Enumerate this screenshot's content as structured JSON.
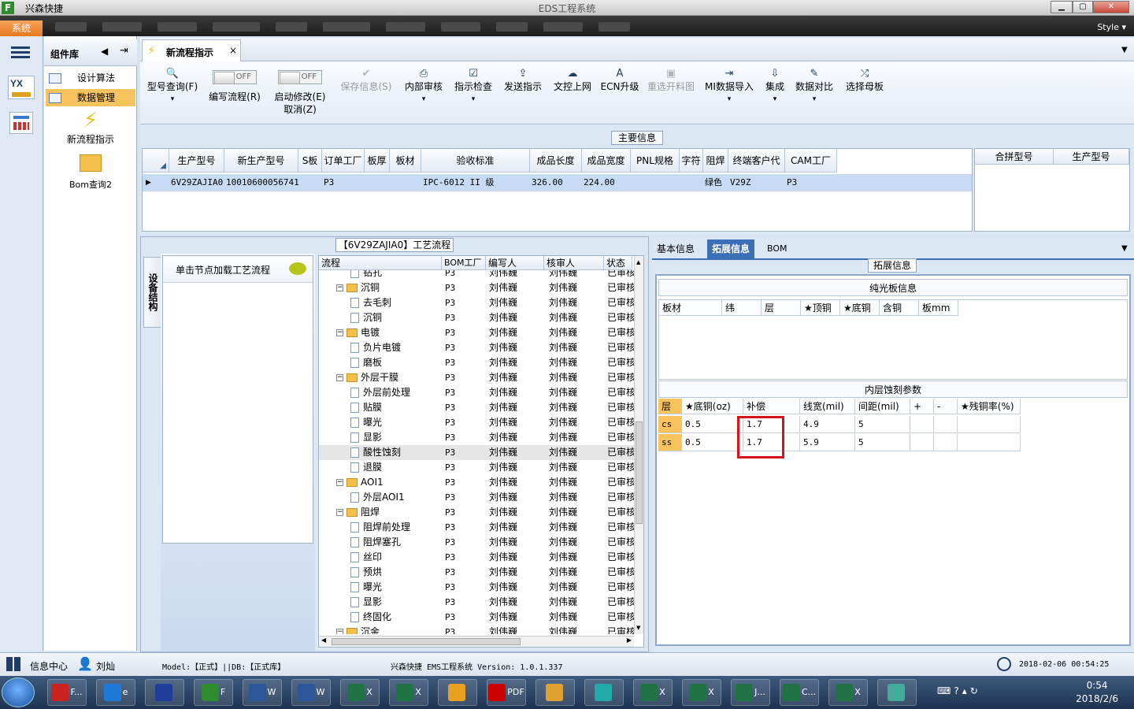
{
  "window": {
    "app_name": "兴森快捷",
    "title": "EDS工程系统",
    "logo": "F",
    "min": "▁",
    "max": "▢",
    "close": "✕"
  },
  "menu": {
    "system": "系统",
    "style": "Style",
    "style_arrow": "▾"
  },
  "sidebar": {
    "title": "组件库",
    "items": [
      {
        "label": "设计算法",
        "selected": false
      },
      {
        "label": "数据管理",
        "selected": true
      }
    ],
    "big_items": [
      "新流程指示",
      "Bom查询2"
    ]
  },
  "main_tab": {
    "label": "新流程指示",
    "close": "×"
  },
  "toolbar": {
    "buttons": [
      {
        "label": "型号查询(F)",
        "icon": "search-icon",
        "glyph": "🔍",
        "disabled": false
      },
      {
        "label": "编写流程(R)",
        "toggle": "OFF",
        "disabled": false
      },
      {
        "label": "启动修改(E)",
        "label2": "取消(Z)",
        "toggle": "OFF",
        "disabled": false
      },
      {
        "label": "保存信息(S)",
        "glyph": "✔",
        "disabled": true
      },
      {
        "label": "内部审核",
        "glyph": "⎙",
        "disabled": false
      },
      {
        "label": "指示检查",
        "glyph": "☑",
        "disabled": false
      },
      {
        "label": "发送指示",
        "glyph": "⇪",
        "disabled": false
      },
      {
        "label": "文控上网",
        "glyph": "☁",
        "disabled": false
      },
      {
        "label": "ECN升级",
        "glyph": "A",
        "disabled": false
      },
      {
        "label": "重选开料图",
        "glyph": "▣",
        "disabled": true
      },
      {
        "label": "MI数据导入",
        "glyph": "⇥",
        "disabled": false
      },
      {
        "label": "集成",
        "glyph": "⇩",
        "disabled": false
      },
      {
        "label": "数据对比",
        "glyph": "✎",
        "disabled": false
      },
      {
        "label": "选择母板",
        "glyph": "⤮",
        "disabled": false
      }
    ]
  },
  "main_info": {
    "title": "主要信息",
    "columns": [
      "生产型号",
      "新生产型号",
      "S板",
      "订单工厂",
      "板厚",
      "板材",
      "验收标准",
      "成品长度",
      "成品宽度",
      "PNL规格",
      "字符",
      "阻焊",
      "终端客户代码",
      "CAM工厂"
    ],
    "row": [
      "6V29ZAJIA0",
      "10010600056741",
      "",
      "P3",
      "",
      "",
      "IPC-6012 II 级",
      "326.00",
      "224.00",
      "",
      "",
      "绿色",
      "V29Z",
      "P3"
    ],
    "right_columns": [
      "合拼型号",
      "生产型号"
    ]
  },
  "process": {
    "title": "【6V29ZAJIA0】工艺流程",
    "side_tab": "设备结构",
    "hint": "单击节点加载工艺流程",
    "columns": [
      "流程",
      "BOM工厂",
      "编写人",
      "核审人",
      "状态"
    ],
    "rows": [
      {
        "level": 2,
        "type": "doc",
        "name": "钻孔",
        "factory": "P3",
        "writer": "刘伟巍",
        "reviewer": "刘伟巍",
        "status": "已审核"
      },
      {
        "level": 1,
        "type": "folder",
        "name": "沉铜",
        "factory": "P3",
        "writer": "刘伟巍",
        "reviewer": "刘伟巍",
        "status": "已审核"
      },
      {
        "level": 2,
        "type": "doc",
        "name": "去毛刺",
        "factory": "P3",
        "writer": "刘伟巍",
        "reviewer": "刘伟巍",
        "status": "已审核"
      },
      {
        "level": 2,
        "type": "doc",
        "name": "沉铜",
        "factory": "P3",
        "writer": "刘伟巍",
        "reviewer": "刘伟巍",
        "status": "已审核"
      },
      {
        "level": 1,
        "type": "folder",
        "name": "电镀",
        "factory": "P3",
        "writer": "刘伟巍",
        "reviewer": "刘伟巍",
        "status": "已审核"
      },
      {
        "level": 2,
        "type": "doc",
        "name": "负片电镀",
        "factory": "P3",
        "writer": "刘伟巍",
        "reviewer": "刘伟巍",
        "status": "已审核"
      },
      {
        "level": 2,
        "type": "doc",
        "name": "磨板",
        "factory": "P3",
        "writer": "刘伟巍",
        "reviewer": "刘伟巍",
        "status": "已审核"
      },
      {
        "level": 1,
        "type": "folder",
        "name": "外层干膜",
        "factory": "P3",
        "writer": "刘伟巍",
        "reviewer": "刘伟巍",
        "status": "已审核"
      },
      {
        "level": 2,
        "type": "doc",
        "name": "外层前处理",
        "factory": "P3",
        "writer": "刘伟巍",
        "reviewer": "刘伟巍",
        "status": "已审核"
      },
      {
        "level": 2,
        "type": "doc",
        "name": "贴膜",
        "factory": "P3",
        "writer": "刘伟巍",
        "reviewer": "刘伟巍",
        "status": "已审核"
      },
      {
        "level": 2,
        "type": "doc",
        "name": "曝光",
        "factory": "P3",
        "writer": "刘伟巍",
        "reviewer": "刘伟巍",
        "status": "已审核"
      },
      {
        "level": 2,
        "type": "doc",
        "name": "显影",
        "factory": "P3",
        "writer": "刘伟巍",
        "reviewer": "刘伟巍",
        "status": "已审核"
      },
      {
        "level": 2,
        "type": "doc",
        "name": "酸性蚀刻",
        "factory": "P3",
        "writer": "刘伟巍",
        "reviewer": "刘伟巍",
        "status": "已审核",
        "highlight": true
      },
      {
        "level": 2,
        "type": "doc",
        "name": "退膜",
        "factory": "P3",
        "writer": "刘伟巍",
        "reviewer": "刘伟巍",
        "status": "已审核"
      },
      {
        "level": 1,
        "type": "folder",
        "name": "AOI1",
        "factory": "P3",
        "writer": "刘伟巍",
        "reviewer": "刘伟巍",
        "status": "已审核"
      },
      {
        "level": 2,
        "type": "doc",
        "name": "外层AOI1",
        "factory": "P3",
        "writer": "刘伟巍",
        "reviewer": "刘伟巍",
        "status": "已审核"
      },
      {
        "level": 1,
        "type": "folder",
        "name": "阻焊",
        "factory": "P3",
        "writer": "刘伟巍",
        "reviewer": "刘伟巍",
        "status": "已审核"
      },
      {
        "level": 2,
        "type": "doc",
        "name": "阻焊前处理",
        "factory": "P3",
        "writer": "刘伟巍",
        "reviewer": "刘伟巍",
        "status": "已审核"
      },
      {
        "level": 2,
        "type": "doc",
        "name": "阻焊塞孔",
        "factory": "P3",
        "writer": "刘伟巍",
        "reviewer": "刘伟巍",
        "status": "已审核"
      },
      {
        "level": 2,
        "type": "doc",
        "name": "丝印",
        "factory": "P3",
        "writer": "刘伟巍",
        "reviewer": "刘伟巍",
        "status": "已审核"
      },
      {
        "level": 2,
        "type": "doc",
        "name": "预烘",
        "factory": "P3",
        "writer": "刘伟巍",
        "reviewer": "刘伟巍",
        "status": "已审核"
      },
      {
        "level": 2,
        "type": "doc",
        "name": "曝光",
        "factory": "P3",
        "writer": "刘伟巍",
        "reviewer": "刘伟巍",
        "status": "已审核"
      },
      {
        "level": 2,
        "type": "doc",
        "name": "显影",
        "factory": "P3",
        "writer": "刘伟巍",
        "reviewer": "刘伟巍",
        "status": "已审核"
      },
      {
        "level": 2,
        "type": "doc",
        "name": "终固化",
        "factory": "P3",
        "writer": "刘伟巍",
        "reviewer": "刘伟巍",
        "status": "已审核"
      },
      {
        "level": 1,
        "type": "folder",
        "name": "沉金",
        "factory": "P3",
        "writer": "刘伟巍",
        "reviewer": "刘伟巍",
        "status": "已审核"
      }
    ]
  },
  "right_panel": {
    "tabs": [
      "基本信息",
      "拓展信息",
      "BOM"
    ],
    "active_tab": 1,
    "title": "拓展信息",
    "bare_board": {
      "title": "纯光板信息",
      "columns": [
        "板材",
        "纬",
        "层",
        "★顶铜",
        "★底铜",
        "含铜",
        "板mm"
      ]
    },
    "inner_etch": {
      "title": "内层蚀刻参数",
      "columns": [
        "层",
        "★底铜(oz)",
        "补偿",
        "线宽(mil)",
        "间距(mil)",
        "+",
        "-",
        "★残铜率(%)"
      ],
      "rows": [
        [
          "cs",
          "0.5",
          "1.7",
          "4.9",
          "5",
          "",
          "",
          ""
        ],
        [
          "ss",
          "0.5",
          "1.7",
          "5.9",
          "5",
          "",
          "",
          ""
        ]
      ]
    }
  },
  "statusbar": {
    "info_center": "信息中心",
    "user": "刘灿",
    "model": "Model:【正式】||DB:【正式库】",
    "version": "兴森快捷 EMS工程系统 Version: 1.0.1.337",
    "datetime": "2018-02-06 00:54:25"
  },
  "taskbar": {
    "clock_time": "0:54",
    "clock_date": "2018/2/6",
    "apps": [
      {
        "name": "F...",
        "icon": "foxit-icon"
      },
      {
        "name": "e",
        "icon": "ie-icon"
      },
      {
        "name": "",
        "icon": "save-icon"
      },
      {
        "name": "F",
        "icon": "eds-app-icon"
      },
      {
        "name": "W",
        "icon": "word-icon"
      },
      {
        "name": "W",
        "icon": "word-icon"
      },
      {
        "name": "X",
        "icon": "excel-icon"
      },
      {
        "name": "X",
        "icon": "excel-icon"
      },
      {
        "name": "",
        "icon": "paint-icon"
      },
      {
        "name": "PDF",
        "icon": "pdf-icon"
      },
      {
        "name": "",
        "icon": "shell-icon"
      },
      {
        "name": "",
        "icon": "eye-icon"
      },
      {
        "name": "X",
        "icon": "excel-icon"
      },
      {
        "name": "X",
        "icon": "excel-icon"
      },
      {
        "name": "J...",
        "icon": "excel-icon"
      },
      {
        "name": "C...",
        "icon": "excel-icon"
      },
      {
        "name": "X",
        "icon": "excel-icon"
      },
      {
        "name": "",
        "icon": "network-icon"
      }
    ]
  }
}
